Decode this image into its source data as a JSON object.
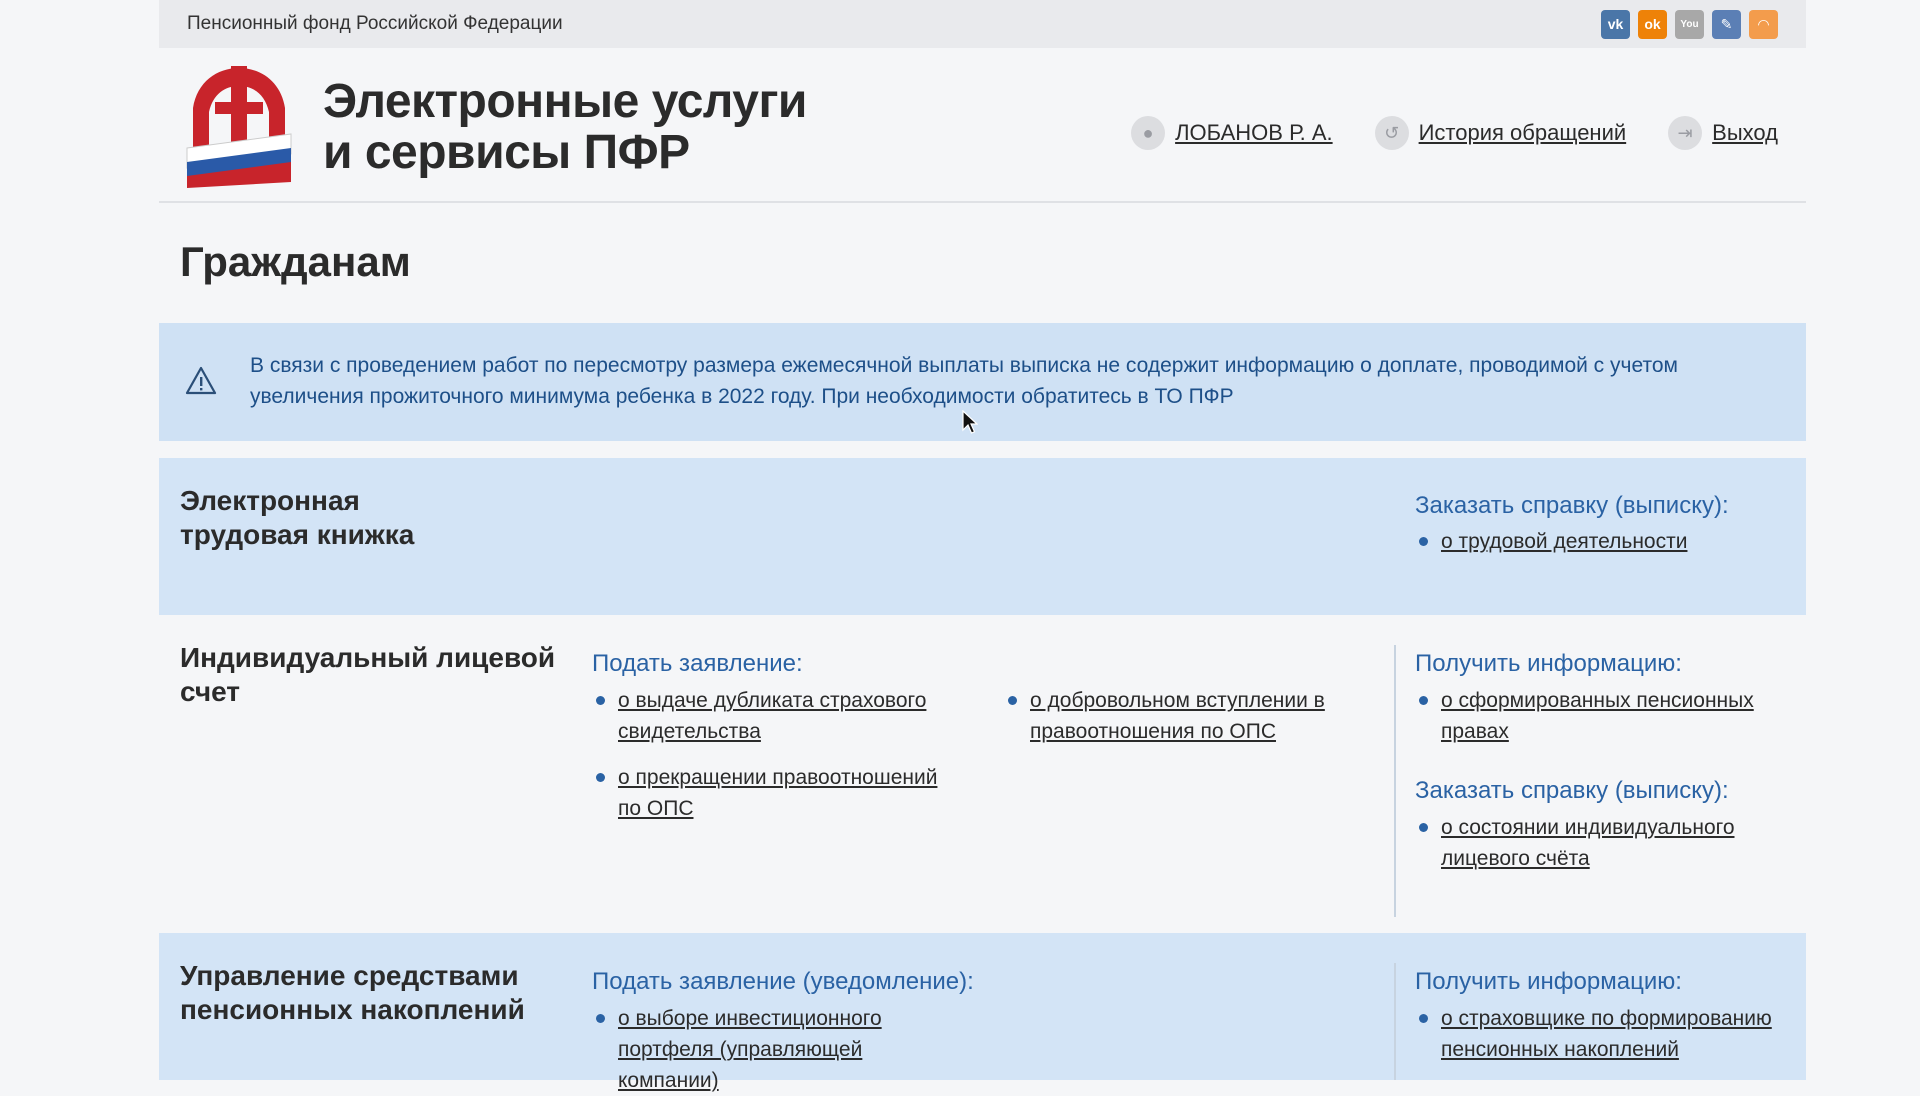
{
  "topbar": {
    "org_name": "Пенсионный фонд Российской Федерации",
    "social": [
      {
        "icon": "vk-icon",
        "label": "vk",
        "color": "#4a76a8"
      },
      {
        "icon": "odnoklassniki-icon",
        "label": "ok",
        "color": "#ee8208"
      },
      {
        "icon": "youtube-icon",
        "label": "You",
        "color": "#a8a8a8"
      },
      {
        "icon": "livejournal-icon",
        "label": "✎",
        "color": "#5b7fb5"
      },
      {
        "icon": "rss-icon",
        "label": "◠",
        "color": "#f39c4c"
      }
    ]
  },
  "header": {
    "title_line1": "Электронные услуги",
    "title_line2": "и сервисы ПФР",
    "user_name": "ЛОБАНОВ Р. А.",
    "history_label": "История обращений",
    "logout_label": "Выход"
  },
  "page": {
    "title": "Гражданам"
  },
  "notice": {
    "text": "В связи с проведением работ по пересмотру размера ежемесячной выплаты выписка не содержит информацию о доплате, проводимой с учетом увеличения прожиточного минимума ребенка в 2022 году. При необходимости обратитесь в ТО ПФР"
  },
  "sections": [
    {
      "title_line1": "Электронная",
      "title_line2": "трудовая книжка",
      "right_heading": "Заказать справку (выписку):",
      "right_links": [
        "о трудовой деятельности"
      ]
    },
    {
      "title_line1": "Индивидуальный лицевой",
      "title_line2": "счет",
      "mid_heading": "Подать заявление:",
      "mid_links": [
        "о выдаче дубликата страхового свидетельства",
        "о прекращении правоотношений по ОПС",
        "о добровольном вступлении в правоотношения по ОПС"
      ],
      "right_heading": "Получить информацию:",
      "right_links": [
        "о сформированных пенсионных правах"
      ],
      "right_heading2": "Заказать справку (выписку):",
      "right_links2": [
        "о состоянии индивидуального лицевого счёта"
      ]
    },
    {
      "title_line1": "Управление средствами",
      "title_line2": "пенсионных накоплений",
      "mid_heading": "Подать заявление (уведомление):",
      "mid_links": [
        "о выборе инвестиционного портфеля (управляющей компании)"
      ],
      "right_heading": "Получить информацию:",
      "right_links": [
        "о страховщике по формированию пенсионных накоплений"
      ]
    }
  ],
  "colors": {
    "accent": "#2a62a4",
    "notice_bg": "#cfe1f4",
    "section_bg": "#d3e4f6"
  }
}
